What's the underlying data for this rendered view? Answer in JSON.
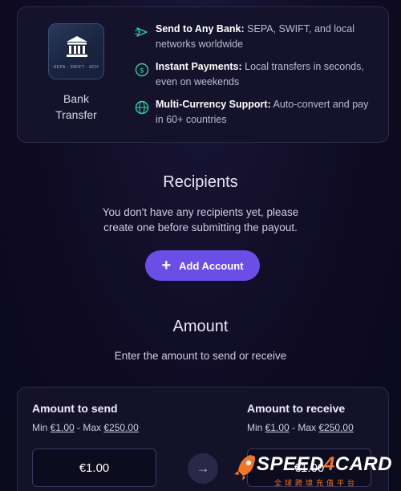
{
  "bank_card": {
    "tile_caption": "SEPA · SWIFT · ACH",
    "label": "Bank Transfer",
    "features": [
      {
        "title": "Send to Any Bank:",
        "text": " SEPA, SWIFT, and local networks worldwide",
        "icon": "send-icon"
      },
      {
        "title": "Instant Payments:",
        "text": " Local transfers in seconds, even on weekends",
        "icon": "instant-coin-icon"
      },
      {
        "title": "Multi-Currency Support:",
        "text": " Auto-convert and pay in 60+ countries",
        "icon": "globe-icon"
      }
    ]
  },
  "recipients": {
    "title": "Recipients",
    "empty_text_line1": "You don't have any recipients yet, please",
    "empty_text_line2": "create one before submitting the payout.",
    "add_button": "Add Account"
  },
  "amount": {
    "title": "Amount",
    "subtitle": "Enter the amount to send or receive",
    "send": {
      "title": "Amount to send",
      "min_label": "Min ",
      "min": "€1.00",
      "sep": " - Max ",
      "max": "€250.00",
      "value": "€1.00"
    },
    "receive": {
      "title": "Amount to receive",
      "min_label": "Min ",
      "min": "€1.00",
      "sep": " - Max ",
      "max": "€250.00",
      "value": "€1.00"
    }
  },
  "watermark": {
    "brand_a": "SPEED",
    "brand_b": "4",
    "brand_c": "CARD",
    "tagline": "全球跨境充值平台"
  },
  "colors": {
    "accent": "#6a4ee6",
    "feature_icon": "#2dd4a8",
    "watermark": "#f0762a"
  }
}
